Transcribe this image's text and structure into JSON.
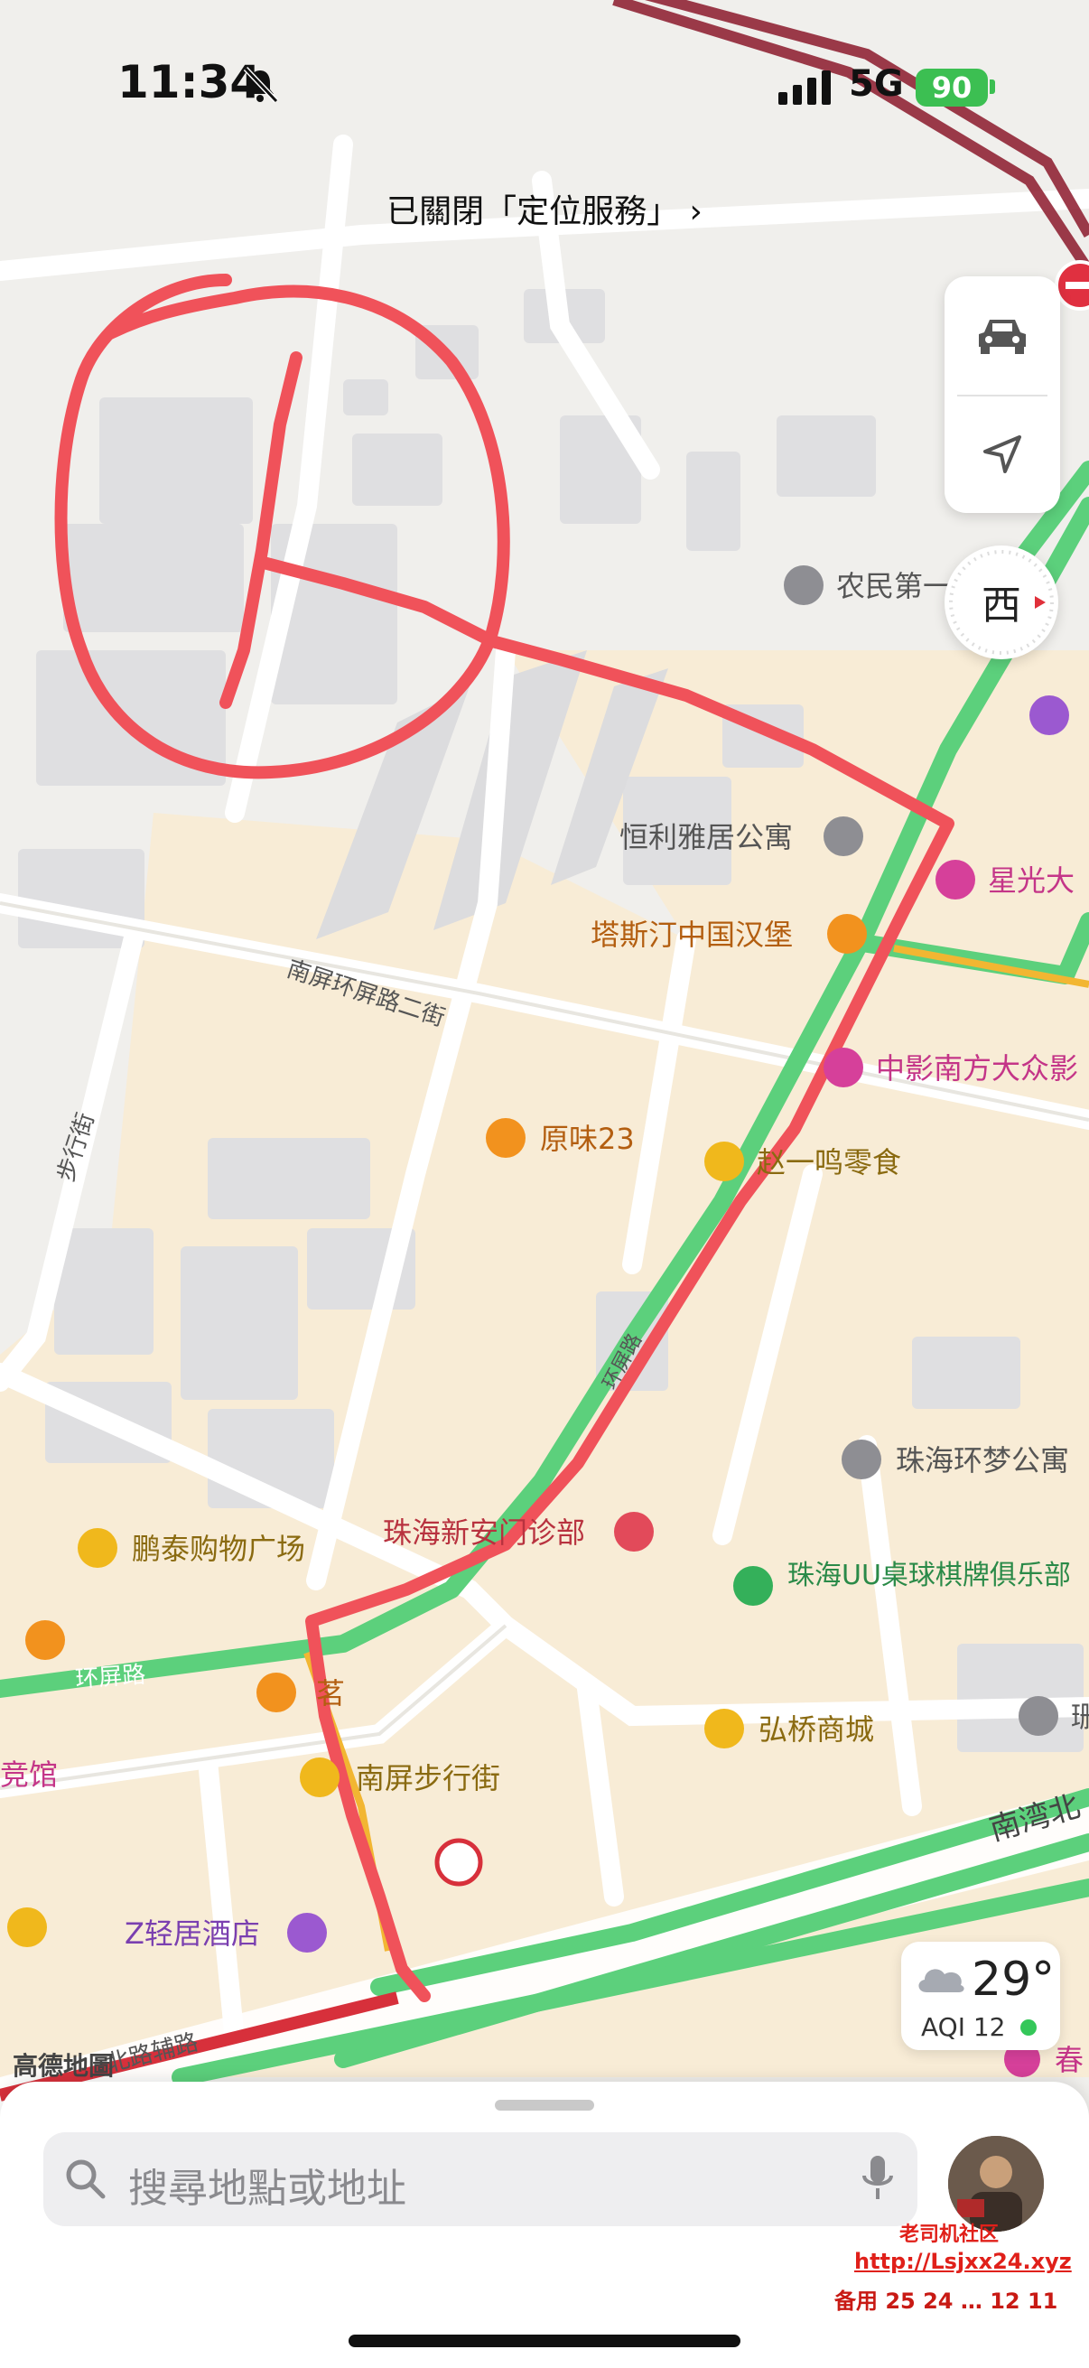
{
  "status_bar": {
    "time": "11:34",
    "network": "5G",
    "battery": "90"
  },
  "location_banner": "已關閉「定位服務」",
  "controls": {
    "compass_label": "西"
  },
  "weather": {
    "temperature": "29°",
    "aqi": "AQI 12"
  },
  "search": {
    "placeholder": "搜尋地點或地址"
  },
  "map": {
    "attribution": "高德地圖",
    "road_labels": [
      "南屏环屏路二街",
      "步行街",
      "环屏路",
      "南湾北",
      "北路辅路",
      "环屏路"
    ],
    "pois": [
      {
        "label": "农民第一",
        "icon": "building-icon"
      },
      {
        "label": "恒利雅居公寓",
        "icon": "building-icon"
      },
      {
        "label": "星光大",
        "icon": "microphone-icon"
      },
      {
        "label": "塔斯汀中国汉堡",
        "icon": "food-icon"
      },
      {
        "label": "中影南方大众影",
        "icon": "cinema-icon"
      },
      {
        "label": "原味23",
        "icon": "food-icon"
      },
      {
        "label": "赵一鸣零食",
        "icon": "shopping-icon"
      },
      {
        "label": "珠海环梦公寓",
        "icon": "building-icon"
      },
      {
        "label": "珠海新安门诊部",
        "icon": "hospital-icon"
      },
      {
        "label": "鹏泰购物广场",
        "icon": "shopping-icon"
      },
      {
        "label": "珠海UU桌球棋牌俱乐部",
        "icon": "sports-icon"
      },
      {
        "label": "茗",
        "icon": "drink-icon"
      },
      {
        "label": "弘桥商城",
        "icon": "shopping-icon"
      },
      {
        "label": "南屏步行街",
        "icon": "shopping-icon"
      },
      {
        "label": "Z轻居酒店",
        "icon": "hotel-icon"
      },
      {
        "label": "竞馆",
        "icon": "venue-icon"
      },
      {
        "label": "春",
        "icon": "venue-icon"
      },
      {
        "label": "珊",
        "icon": "building-icon"
      }
    ]
  },
  "watermark": {
    "line1": "老司机社区",
    "line2": "http://Lsjxx24.xyz",
    "line3": "备用 25 24  … 12 11"
  },
  "colors": {
    "route_green": "#5cd07c",
    "road_red": "#d7303b",
    "annotation": "#f0525a",
    "highway_orange": "#f2b632"
  }
}
